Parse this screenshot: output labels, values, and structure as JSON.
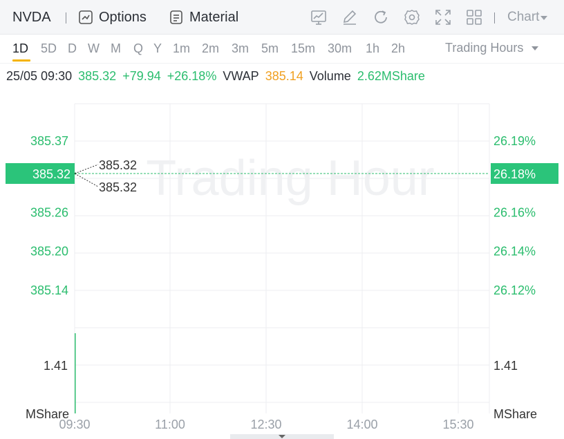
{
  "toolbar": {
    "symbol": "NVDA",
    "options_label": "Options",
    "material_label": "Material",
    "chart_label": "Chart",
    "icons": [
      "indicator-icon",
      "draw-icon",
      "refresh-icon",
      "settings-icon",
      "fullscreen-icon",
      "layout-icon"
    ]
  },
  "periods": {
    "items": [
      "1D",
      "5D",
      "D",
      "W",
      "M",
      "Q",
      "Y",
      "1m",
      "2m",
      "3m",
      "5m",
      "15m",
      "30m",
      "1h",
      "2h"
    ],
    "active": "1D",
    "session_label": "Trading Hours"
  },
  "quote": {
    "datetime": "25/05 09:30",
    "price": "385.32",
    "change": "+79.94",
    "change_pct": "+26.18%",
    "vwap_label": "VWAP",
    "vwap": "385.14",
    "volume_label": "Volume",
    "volume": "2.62MShare"
  },
  "chart": {
    "watermark": "Trading Hour",
    "colors": {
      "up": "#2bbd6e",
      "vwap": "#f0a020",
      "grid": "#eceef1",
      "tag_bg": "#2bc47a"
    }
  },
  "chart_data": {
    "type": "line",
    "x_ticks": [
      "09:30",
      "11:00",
      "12:30",
      "14:00",
      "15:30"
    ],
    "price_axis": {
      "ticks": [
        "385.37",
        "385.26",
        "385.20",
        "385.14"
      ],
      "current": "385.32"
    },
    "percent_axis": {
      "ticks": [
        "26.19%",
        "26.16%",
        "26.14%",
        "26.12%"
      ],
      "current": "26.18%"
    },
    "price_annotations": [
      "385.32",
      "385.32"
    ],
    "series": [
      {
        "x": [
          "09:30"
        ],
        "values": [
          385.32
        ]
      }
    ],
    "volume_axis": {
      "tick": "1.41",
      "unit": "MShare"
    },
    "volume": [
      {
        "x": "09:30",
        "value": 2.62
      }
    ]
  }
}
